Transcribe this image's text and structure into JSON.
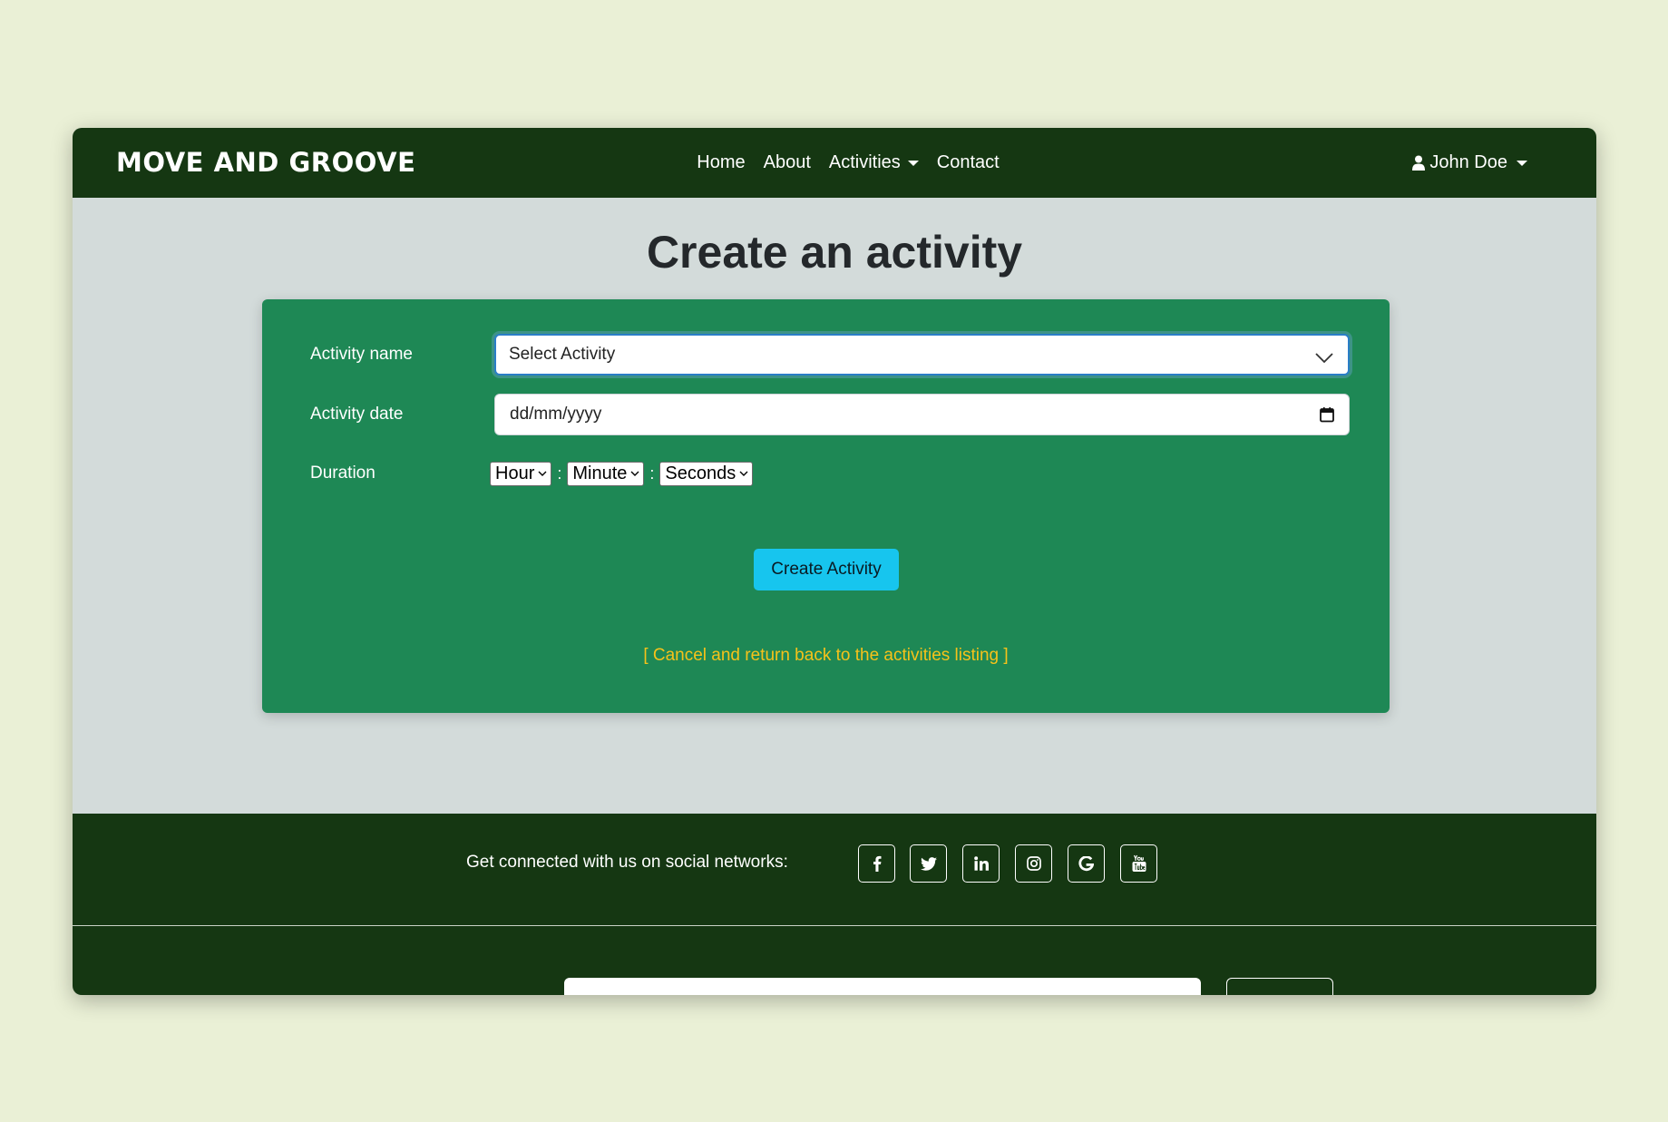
{
  "colors": {
    "page_background": "#eaf0d6",
    "nav_background": "#153712",
    "content_background": "#d3dbda",
    "card_background": "#1e8855",
    "primary_button": "#17c5ee",
    "cancel_link": "#f6c21a",
    "focus_border": "#2a7ec7"
  },
  "navbar": {
    "brand": "MOVE AND GROOVE",
    "links": {
      "home": "Home",
      "about": "About",
      "activities": "Activities",
      "contact": "Contact"
    },
    "user": {
      "name": "John Doe",
      "icon": "user-icon"
    }
  },
  "main": {
    "title": "Create an activity",
    "form": {
      "activity_name_label": "Activity name",
      "activity_name_selected": "Select Activity",
      "activity_date_label": "Activity date",
      "activity_date_placeholder": "dd/mm/yyyy",
      "duration_label": "Duration",
      "duration": {
        "hour": "Hour",
        "minute": "Minute",
        "seconds": "Seconds",
        "separator": ":"
      },
      "submit_label": "Create Activity",
      "cancel_link": "[ Cancel and return back to the activities listing ]"
    }
  },
  "footer": {
    "social_text": "Get connected with us on social networks:",
    "social_icons": [
      "facebook-icon",
      "twitter-icon",
      "linkedin-icon",
      "instagram-icon",
      "google-icon",
      "youtube-icon"
    ]
  }
}
